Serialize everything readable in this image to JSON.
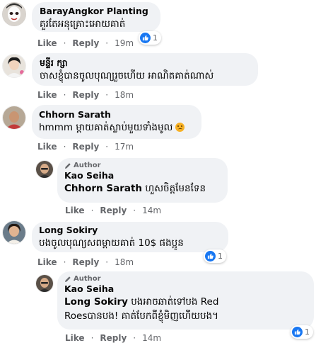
{
  "actions": {
    "like": "Like",
    "reply": "Reply",
    "sep": "·"
  },
  "author_badge": "Author",
  "comments": [
    {
      "name": "BarayAngkor Planting",
      "text": "គួរតែអនុគ្រោះអោយគាត់",
      "time": "19m",
      "reactions": "1"
    },
    {
      "name": "មន្ទីរ ក្សា",
      "text": "ចាសខ្ញុំបានចូលបុណ្យរួចហើយ អាណិតគាត់ណាស់",
      "time": "18m"
    },
    {
      "name": "Chhorn Sarath",
      "text": "hmmm ម្តាយគាត់ស្លាប់មួយទាំងមូល",
      "time": "17m",
      "emoji": "sad-face"
    },
    {
      "name": "Kao Seiha",
      "is_author": true,
      "mention": "Chhorn Sarath",
      "text": " ហួសចិត្តមែនទែន",
      "time": "14m"
    },
    {
      "name": "Long Sokiry",
      "text": "បងចូលបុណ្យសពម្តាយគាត់ 10$ ផងប្អូន",
      "time": "18m",
      "reactions": "1"
    },
    {
      "name": "Kao Seiha",
      "is_author": true,
      "mention": "Long Sokiry",
      "text_line1": " បងអាចឆាត់ទៅបង Red",
      "text_line2": "Roesបានបង! គាត់បែកពីខ្ញុំមិញហើយបង។",
      "time": "14m",
      "reactions": "1"
    }
  ],
  "colors": {
    "like_blue": "#1877f2",
    "bubble": "#f0f2f5",
    "meta": "#65676b"
  }
}
